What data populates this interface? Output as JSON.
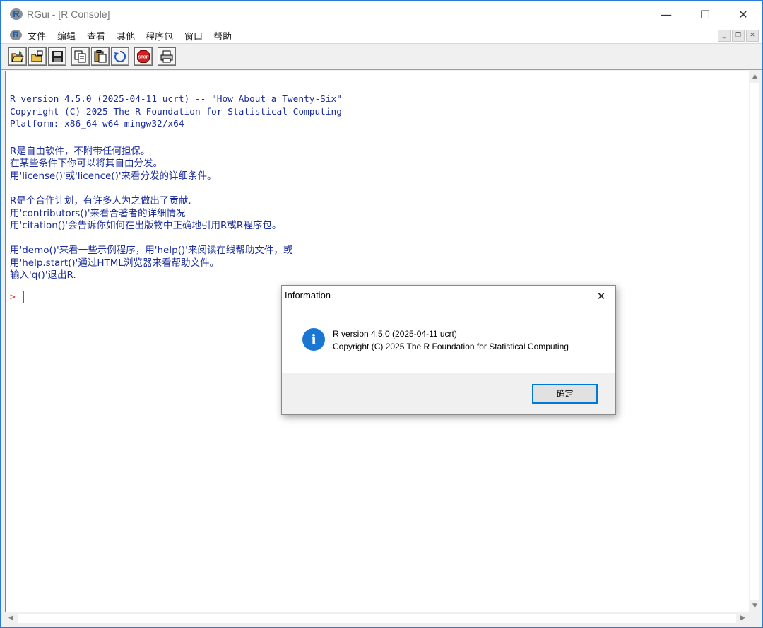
{
  "window": {
    "icon_letter": "R",
    "title": "RGui - [R Console]",
    "minimize": "—",
    "maximize": "☐",
    "close": "✕"
  },
  "menu": {
    "items": [
      "文件",
      "编辑",
      "查看",
      "其他",
      "程序包",
      "窗口",
      "帮助"
    ],
    "mdi_min": "_",
    "mdi_restore": "❐",
    "mdi_close": "✕"
  },
  "toolbar": {
    "buttons": [
      "open-script-icon",
      "load-workspace-icon",
      "save-icon",
      "copy-icon",
      "paste-icon",
      "refresh-icon",
      "stop-icon",
      "print-icon"
    ],
    "stop_label": "STOP"
  },
  "console": {
    "lines": [
      "R version 4.5.0 (2025-04-11 ucrt) -- \"How About a Twenty-Six\"",
      "Copyright (C) 2025 The R Foundation for Statistical Computing",
      "Platform: x86_64-w64-mingw32/x64",
      "R是自由软件，不附带任何担保。",
      "在某些条件下你可以将其自由分发。",
      "用'license()'或'licence()'来看分发的详细条件。",
      "R是个合作计划，有许多人为之做出了贡献.",
      "用'contributors()'来看合著者的详细情况",
      "用'citation()'会告诉你如何在出版物中正确地引用R或R程序包。",
      "用'demo()'来看一些示例程序，用'help()'来阅读在线帮助文件，或",
      "用'help.start()'通过HTML浏览器来看帮助文件。",
      "输入'q()'退出R."
    ],
    "prompt": ">"
  },
  "scrollbars": {
    "up": "▲",
    "down": "▼",
    "left": "◀",
    "right": "▶"
  },
  "dialog": {
    "title": "Information",
    "close": "✕",
    "icon_glyph": "i",
    "message_line1": "R version 4.5.0 (2025-04-11 ucrt)",
    "message_line2": "Copyright (C) 2025 The R Foundation for Statistical Computing",
    "ok_label": "确定"
  }
}
